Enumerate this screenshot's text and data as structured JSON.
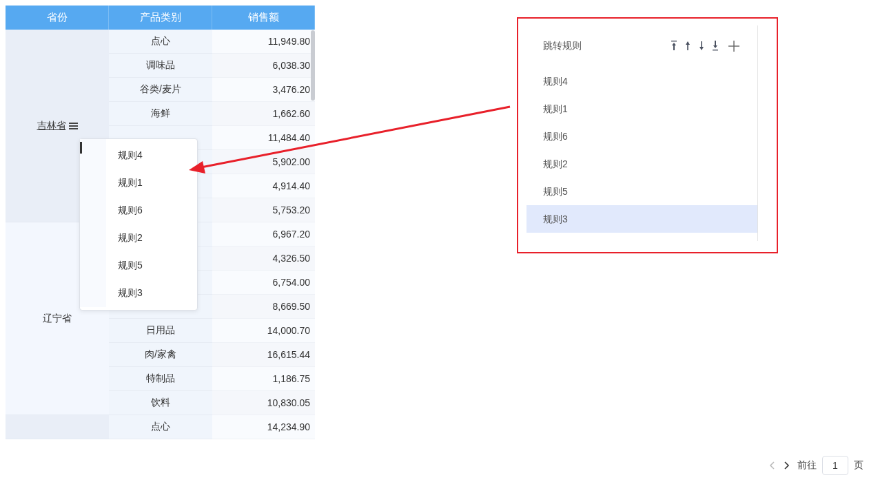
{
  "table": {
    "columns": [
      "省份",
      "产品类别",
      "销售额"
    ],
    "groups": [
      {
        "province": "吉林省",
        "kind": "link",
        "menu": true,
        "rows": [
          {
            "category": "点心",
            "sales": "11,949.80"
          },
          {
            "category": "调味品",
            "sales": "6,038.30"
          },
          {
            "category": "谷类/麦片",
            "sales": "3,476.20"
          },
          {
            "category": "海鲜",
            "sales": "1,662.60"
          },
          {
            "sales": "11,484.40"
          },
          {
            "sales": "5,902.00"
          },
          {
            "sales": "4,914.40"
          },
          {
            "sales": "5,753.20"
          }
        ]
      },
      {
        "province": "辽宁省",
        "kind": "plain",
        "menu": false,
        "rows": [
          {
            "sales": "6,967.20"
          },
          {
            "sales": "4,326.50"
          },
          {
            "sales": "6,754.00"
          },
          {
            "sales": "8,669.50"
          },
          {
            "category": "日用品",
            "sales": "14,000.70"
          },
          {
            "category": "肉/家禽",
            "sales": "16,615.44"
          },
          {
            "category": "特制品",
            "sales": "1,186.75"
          },
          {
            "category": "饮料",
            "sales": "10,830.05"
          }
        ]
      },
      {
        "rows": [
          {
            "category": "点心",
            "sales": "14,234.90"
          }
        ]
      }
    ]
  },
  "popup_menu": {
    "items": [
      "规则4",
      "规则1",
      "规则6",
      "规则2",
      "规则5",
      "规则3"
    ]
  },
  "rules_panel": {
    "title": "跳转规则",
    "tools": [
      {
        "kind": "top"
      },
      {
        "kind": "up"
      },
      {
        "kind": "down"
      },
      {
        "kind": "bottom"
      },
      {
        "kind": "add"
      }
    ],
    "rules": [
      {
        "label": "规则4",
        "selected": false
      },
      {
        "label": "规则1",
        "selected": false
      },
      {
        "label": "规则6",
        "selected": false
      },
      {
        "label": "规则2",
        "selected": false
      },
      {
        "label": "规则5",
        "selected": false
      },
      {
        "label": "规则3",
        "selected": true
      }
    ]
  },
  "pagination": {
    "prev_disabled": true,
    "next_disabled": false,
    "goto_label": "前往",
    "page": "1",
    "page_suffix": "页"
  }
}
